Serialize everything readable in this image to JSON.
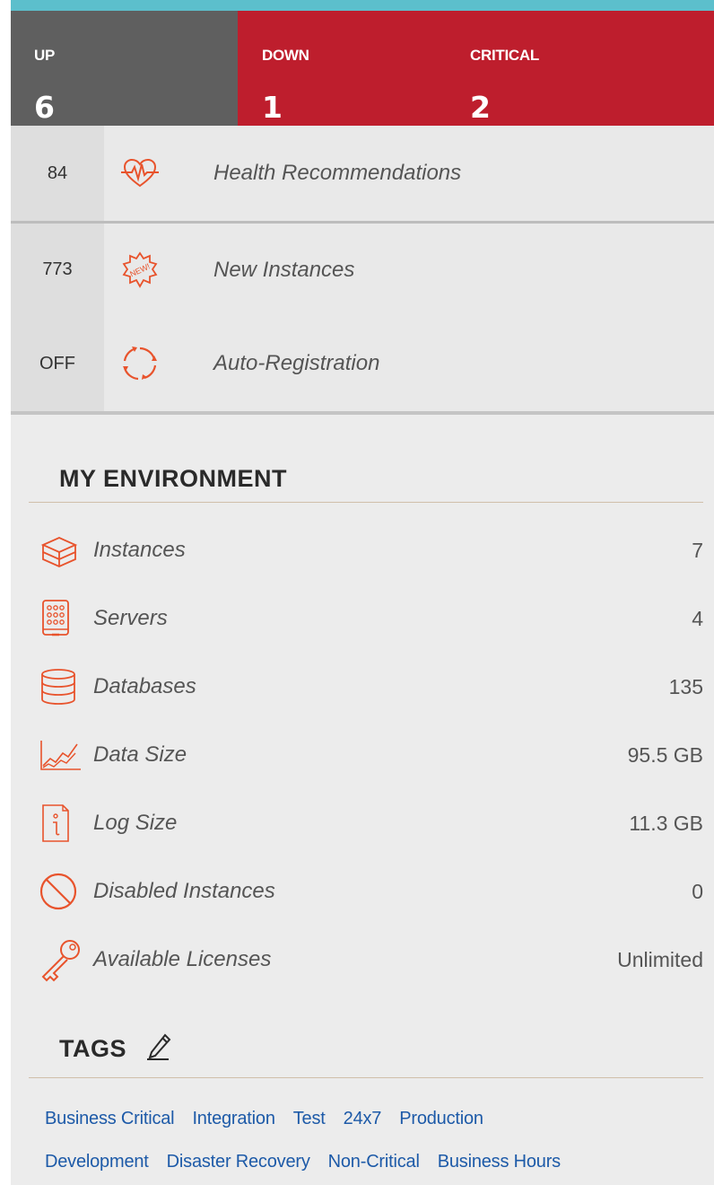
{
  "status": {
    "up": {
      "label": "UP",
      "count": "6"
    },
    "down": {
      "label": "DOWN",
      "count": "1"
    },
    "critical": {
      "label": "CRITICAL",
      "count": "2"
    }
  },
  "alerts": [
    {
      "count": "84",
      "label": "Health Recommendations",
      "icon": "heartbeat-icon"
    },
    {
      "count": "773",
      "label": "New Instances",
      "icon": "new-badge-icon"
    },
    {
      "count": "OFF",
      "label": "Auto-Registration",
      "icon": "refresh-cycle-icon"
    }
  ],
  "environment": {
    "title": "MY ENVIRONMENT",
    "items": [
      {
        "label": "Instances",
        "value": "7",
        "icon": "instances-icon"
      },
      {
        "label": "Servers",
        "value": "4",
        "icon": "server-icon"
      },
      {
        "label": "Databases",
        "value": "135",
        "icon": "database-icon"
      },
      {
        "label": "Data Size",
        "value": "95.5 GB",
        "icon": "line-chart-icon"
      },
      {
        "label": "Log Size",
        "value": "11.3 GB",
        "icon": "log-file-icon"
      },
      {
        "label": "Disabled Instances",
        "value": "0",
        "icon": "disabled-icon"
      },
      {
        "label": "Available Licenses",
        "value": "Unlimited",
        "icon": "key-icon"
      }
    ]
  },
  "tags": {
    "title": "TAGS",
    "edit_icon": "pencil-icon",
    "rows": [
      [
        "Business Critical",
        "Integration",
        "Test",
        "24x7",
        "Production"
      ],
      [
        "Development",
        "Disaster Recovery",
        "Non-Critical",
        "Business Hours"
      ]
    ]
  },
  "colors": {
    "accent_top": "#5cbfcc",
    "up_bg": "#5f5f5f",
    "alert_bg": "#be1e2d",
    "icon_orange": "#e8532c",
    "tag_link": "#1d5aa8"
  }
}
